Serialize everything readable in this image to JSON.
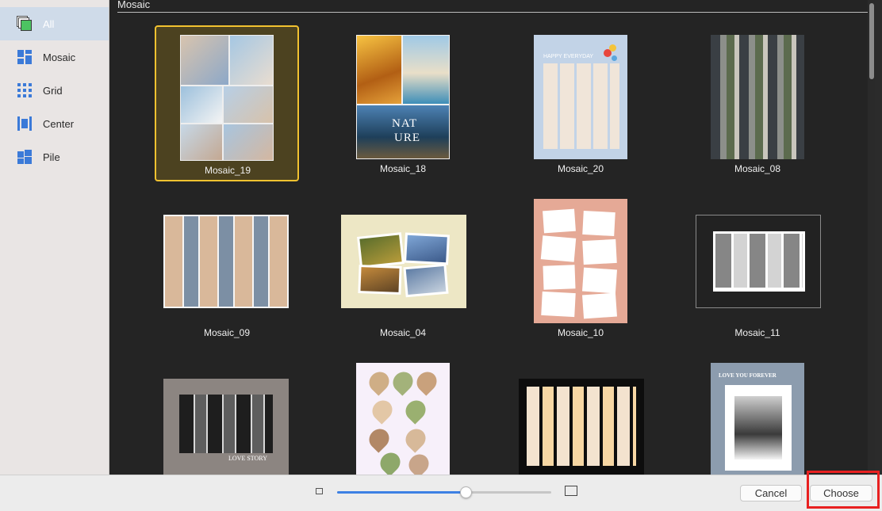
{
  "sidebar": {
    "items": [
      {
        "label": "All",
        "icon": "stack-icon",
        "selected": true
      },
      {
        "label": "Mosaic",
        "icon": "mosaic-icon"
      },
      {
        "label": "Grid",
        "icon": "grid-icon"
      },
      {
        "label": "Center",
        "icon": "center-icon"
      },
      {
        "label": "Pile",
        "icon": "pile-icon"
      }
    ]
  },
  "main": {
    "section_title": "Mosaic",
    "templates": [
      {
        "label": "Mosaic_19",
        "selected": true
      },
      {
        "label": "Mosaic_18"
      },
      {
        "label": "Mosaic_20"
      },
      {
        "label": "Mosaic_08"
      },
      {
        "label": "Mosaic_09"
      },
      {
        "label": "Mosaic_04"
      },
      {
        "label": "Mosaic_10"
      },
      {
        "label": "Mosaic_11"
      },
      {
        "label": ""
      },
      {
        "label": ""
      },
      {
        "label": ""
      },
      {
        "label": ""
      }
    ],
    "thumb_text": {
      "nature_line1": "NAT",
      "nature_line2": "URE",
      "happy_everyday": "HAPPY EVERYDAY",
      "love_story": "LOVE STORY",
      "love_forever": "LOVE YOU FOREVER"
    }
  },
  "footer": {
    "zoom_level": 0.6,
    "cancel_label": "Cancel",
    "choose_label": "Choose"
  },
  "colors": {
    "accent": "#3d80e4",
    "selection_border": "#f2c230",
    "highlight": "#e82020"
  }
}
